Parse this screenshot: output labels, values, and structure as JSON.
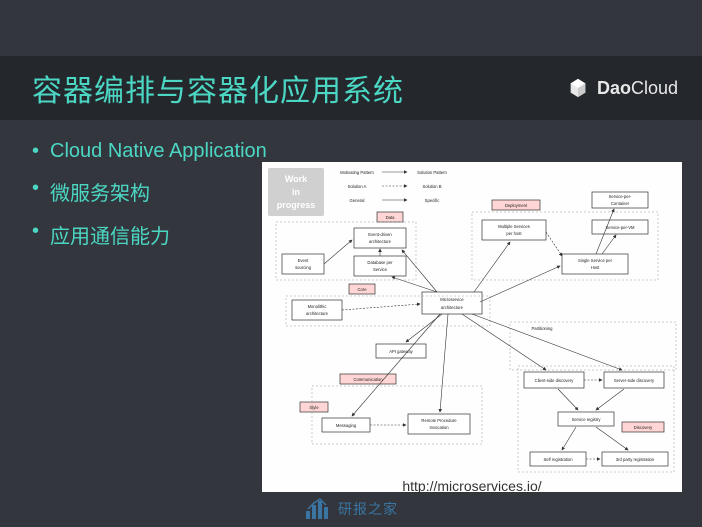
{
  "slide": {
    "title": "容器编排与容器化应用系统",
    "brand": {
      "prefix": "Dao",
      "suffix": "Cloud"
    },
    "bullets": [
      "Cloud Native Application",
      "微服务架构",
      "应用通信能力"
    ],
    "diagram": {
      "wip": {
        "l1": "Work",
        "l2": "in",
        "l3": "progress"
      },
      "legend": {
        "motivating": "Motivating Pattern",
        "solution": "Solution Pattern",
        "solA": "Solution A",
        "solB": "Solution B",
        "general": "General",
        "specific": "Specific"
      },
      "labels": {
        "data": "Data",
        "deployment": "Deployment",
        "core": "Core",
        "partitioning": "Partitioning",
        "communication": "Communication",
        "style": "Style",
        "discovery": "Discovery"
      },
      "boxes": {
        "event_sourcing": "Event sourcing",
        "event_driven": "Event-driven architecture",
        "db_per_service": "Database per Service",
        "monolithic": "Monolithic architecture",
        "microservice": "Microservice architecture",
        "multi_svc": "Multiple Services per host",
        "single_svc": "Single Service per Host",
        "svc_container": "Service-per-Container",
        "svc_vm": "Service-per-VM",
        "api_gateway": "API gateway",
        "messaging": "Messaging",
        "rpc": "Remote Procedure Invocation",
        "client_disc": "Client-side discovery",
        "server_disc": "Server-side discovery",
        "svc_registry": "Service registry",
        "self_reg": "Self registration",
        "third_party": "3rd party registration"
      },
      "caption": "http://microservices.io/"
    },
    "watermark": "研报之家"
  }
}
